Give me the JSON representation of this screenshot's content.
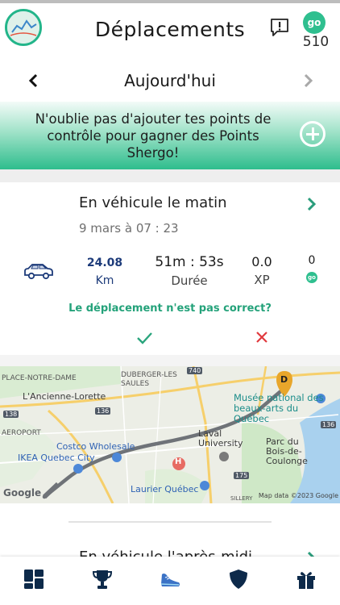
{
  "header": {
    "title": "Déplacements",
    "go_badge": "go",
    "points": "510"
  },
  "date_nav": {
    "label": "Aujourd'hui"
  },
  "banner": {
    "text": "N'oublie pas d'ajouter tes points de contrôle pour gagner des Points Shergo!"
  },
  "trip": {
    "title": "En véhicule le matin",
    "date": "9 mars à 07 : 23",
    "distance_value": "24.08",
    "distance_unit": "Km",
    "duration_value": "51m : 53s",
    "duration_label": "Durée",
    "xp_value": "0.0",
    "xp_label": "XP",
    "points_value": "0",
    "points_icon": "go",
    "question": "Le déplacement n'est pas correct?"
  },
  "map": {
    "labels": {
      "place_notre_dame": "PLACE-NOTRE-DAME",
      "duberger": "DUBERGER-LES SAULES",
      "ancienne_lorette": "L'Ancienne-Lorette",
      "musee": "Musée national des beaux-arts du Québec",
      "aeroport": "AEROPORT",
      "laval": "Laval University",
      "parc": "Parc du Bois-de-Coulonge",
      "costco": "Costco Wholesale",
      "ikea": "IKEA Quebec City",
      "laurier": "Laurier Québec",
      "sillery": "SILLERY",
      "marker": "D",
      "hospital": "H",
      "r740": "740",
      "r136a": "136",
      "r136b": "136",
      "r138": "138",
      "r175": "175"
    },
    "google": "Google",
    "attribution": "Map data ©2023 Google"
  },
  "next_trip": {
    "title": "En véhicule l'après-midi"
  },
  "colors": {
    "accent": "#2fbf8f",
    "link": "#24a27a",
    "cancel": "#e0393e",
    "route": "#6f7378"
  },
  "icons": {
    "bottom_nav": [
      "dashboard-icon",
      "trophy-icon",
      "shoe-icon",
      "shield-icon",
      "gift-icon"
    ]
  }
}
